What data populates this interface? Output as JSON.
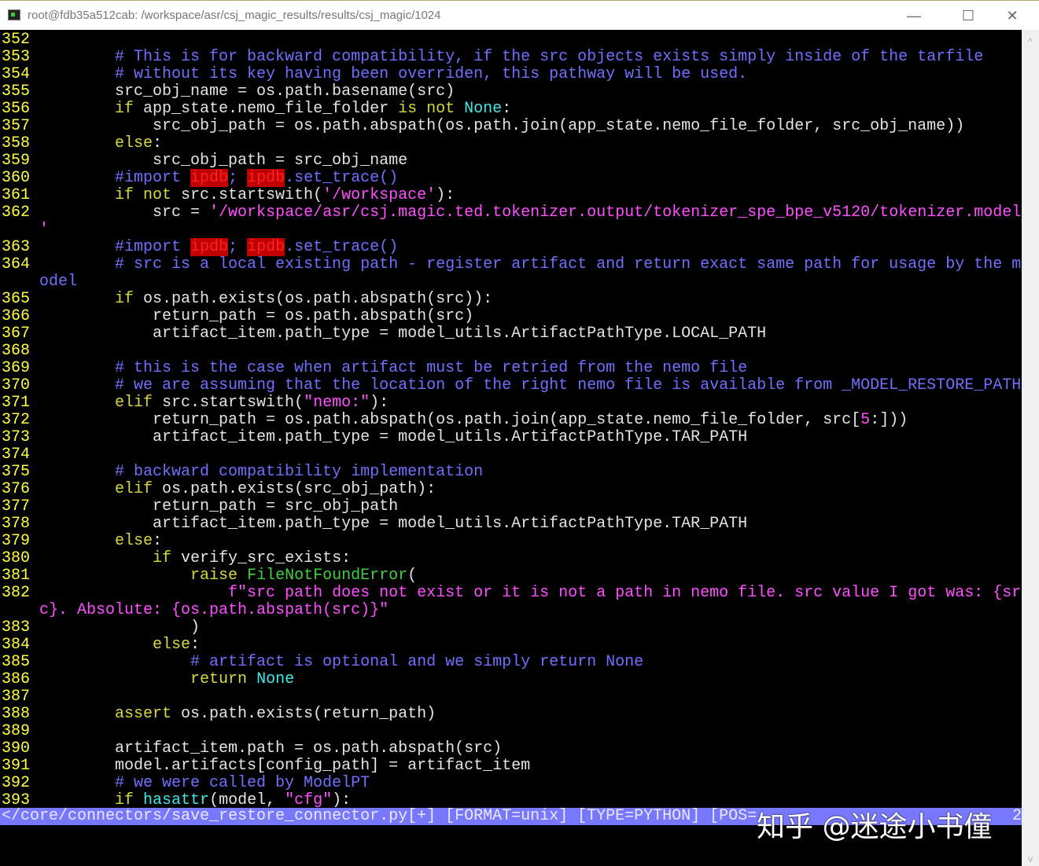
{
  "window": {
    "title": "root@fdb35a512cab: /workspace/asr/csj_magic_results/results/csj_magic/1024",
    "minimize": "—",
    "maximize": "☐",
    "close": "✕"
  },
  "colors": {
    "line_number": "#ffff40",
    "keyword": "#d8d840",
    "comment": "#7070ff",
    "string": "#ff50ff",
    "builtin": "#40e8e8",
    "exception": "#40d040",
    "search_highlight": "#c00000",
    "status_bg": "#7878ff"
  },
  "rows": [
    {
      "num": "352",
      "t": []
    },
    {
      "num": "353",
      "t": [
        [
          "n",
          "        "
        ],
        [
          "c",
          "# This is for backward compatibility, if the src objects exists simply inside of the tarfile"
        ]
      ]
    },
    {
      "num": "354",
      "t": [
        [
          "n",
          "        "
        ],
        [
          "c",
          "# without its key having been overriden, this pathway will be used."
        ]
      ]
    },
    {
      "num": "355",
      "t": [
        [
          "n",
          "        src_obj_name = os.path.basename(src)"
        ]
      ]
    },
    {
      "num": "356",
      "t": [
        [
          "n",
          "        "
        ],
        [
          "k",
          "if"
        ],
        [
          "n",
          " app_state.nemo_file_folder "
        ],
        [
          "k",
          "is not"
        ],
        [
          "n",
          " "
        ],
        [
          "b",
          "None"
        ],
        [
          "n",
          ":"
        ]
      ]
    },
    {
      "num": "357",
      "t": [
        [
          "n",
          "            src_obj_path = os.path.abspath(os.path.join(app_state.nemo_file_folder, src_obj_name))"
        ]
      ]
    },
    {
      "num": "358",
      "t": [
        [
          "n",
          "        "
        ],
        [
          "k",
          "else"
        ],
        [
          "n",
          ":"
        ]
      ]
    },
    {
      "num": "359",
      "t": [
        [
          "n",
          "            src_obj_path = src_obj_name"
        ]
      ]
    },
    {
      "num": "360",
      "t": [
        [
          "n",
          "        "
        ],
        [
          "c",
          "#import "
        ],
        [
          "h",
          "ipdb"
        ],
        [
          "c",
          "; "
        ],
        [
          "h",
          "ipdb"
        ],
        [
          "c",
          ".set_trace()"
        ]
      ]
    },
    {
      "num": "361",
      "t": [
        [
          "n",
          "        "
        ],
        [
          "k",
          "if not"
        ],
        [
          "n",
          " src.startswith("
        ],
        [
          "s",
          "'/workspace'"
        ],
        [
          "n",
          "):"
        ]
      ]
    },
    {
      "num": "362",
      "t": [
        [
          "n",
          "            src = "
        ],
        [
          "s",
          "'/workspace/asr/csj.magic.ted.tokenizer.output/tokenizer_spe_bpe_v5120/tokenizer.model"
        ]
      ]
    },
    {
      "num": "",
      "t": [
        [
          "s",
          "'"
        ]
      ]
    },
    {
      "num": "363",
      "t": [
        [
          "n",
          "        "
        ],
        [
          "c",
          "#import "
        ],
        [
          "h",
          "ipdb"
        ],
        [
          "c",
          "; "
        ],
        [
          "h",
          "ipdb"
        ],
        [
          "c",
          ".set_trace()"
        ]
      ]
    },
    {
      "num": "364",
      "t": [
        [
          "n",
          "        "
        ],
        [
          "c",
          "# src is a local existing path - register artifact and return exact same path for usage by the m"
        ]
      ]
    },
    {
      "num": "",
      "t": [
        [
          "c",
          "odel"
        ]
      ]
    },
    {
      "num": "365",
      "t": [
        [
          "n",
          "        "
        ],
        [
          "k",
          "if"
        ],
        [
          "n",
          " os.path.exists(os.path.abspath(src)):"
        ]
      ]
    },
    {
      "num": "366",
      "t": [
        [
          "n",
          "            return_path = os.path.abspath(src)"
        ]
      ]
    },
    {
      "num": "367",
      "t": [
        [
          "n",
          "            artifact_item.path_type = model_utils.ArtifactPathType.LOCAL_PATH"
        ]
      ]
    },
    {
      "num": "368",
      "t": []
    },
    {
      "num": "369",
      "t": [
        [
          "n",
          "        "
        ],
        [
          "c",
          "# this is the case when artifact must be retried from the nemo file"
        ]
      ]
    },
    {
      "num": "370",
      "t": [
        [
          "n",
          "        "
        ],
        [
          "c",
          "# we are assuming that the location of the right nemo file is available from _MODEL_RESTORE_PATH"
        ]
      ]
    },
    {
      "num": "371",
      "t": [
        [
          "n",
          "        "
        ],
        [
          "k",
          "elif"
        ],
        [
          "n",
          " src.startswith("
        ],
        [
          "s",
          "\"nemo:\""
        ],
        [
          "n",
          "):"
        ]
      ]
    },
    {
      "num": "372",
      "t": [
        [
          "n",
          "            return_path = os.path.abspath(os.path.join(app_state.nemo_file_folder, src["
        ],
        [
          "s",
          "5"
        ],
        [
          "n",
          ":]))"
        ]
      ]
    },
    {
      "num": "373",
      "t": [
        [
          "n",
          "            artifact_item.path_type = model_utils.ArtifactPathType.TAR_PATH"
        ]
      ]
    },
    {
      "num": "374",
      "t": []
    },
    {
      "num": "375",
      "t": [
        [
          "n",
          "        "
        ],
        [
          "c",
          "# backward compatibility implementation"
        ]
      ]
    },
    {
      "num": "376",
      "t": [
        [
          "n",
          "        "
        ],
        [
          "k",
          "elif"
        ],
        [
          "n",
          " os.path.exists(src_obj_path):"
        ]
      ]
    },
    {
      "num": "377",
      "t": [
        [
          "n",
          "            return_path = src_obj_path"
        ]
      ]
    },
    {
      "num": "378",
      "t": [
        [
          "n",
          "            artifact_item.path_type = model_utils.ArtifactPathType.TAR_PATH"
        ]
      ]
    },
    {
      "num": "379",
      "t": [
        [
          "n",
          "        "
        ],
        [
          "k",
          "else"
        ],
        [
          "n",
          ":"
        ]
      ]
    },
    {
      "num": "380",
      "t": [
        [
          "n",
          "            "
        ],
        [
          "k",
          "if"
        ],
        [
          "n",
          " verify_src_exists:"
        ]
      ]
    },
    {
      "num": "381",
      "t": [
        [
          "n",
          "                "
        ],
        [
          "k",
          "raise"
        ],
        [
          "n",
          " "
        ],
        [
          "e",
          "FileNotFoundError"
        ],
        [
          "n",
          "("
        ]
      ]
    },
    {
      "num": "382",
      "t": [
        [
          "n",
          "                    "
        ],
        [
          "s",
          "f\"src path does not exist or it is not a path in nemo file. src value I got was: {sr"
        ]
      ]
    },
    {
      "num": "",
      "t": [
        [
          "s",
          "c}. Absolute: {os.path.abspath(src)}\""
        ]
      ]
    },
    {
      "num": "383",
      "t": [
        [
          "n",
          "                )"
        ]
      ]
    },
    {
      "num": "384",
      "t": [
        [
          "n",
          "            "
        ],
        [
          "k",
          "else"
        ],
        [
          "n",
          ":"
        ]
      ]
    },
    {
      "num": "385",
      "t": [
        [
          "n",
          "                "
        ],
        [
          "c",
          "# artifact is optional and we simply return None"
        ]
      ]
    },
    {
      "num": "386",
      "t": [
        [
          "n",
          "                "
        ],
        [
          "k",
          "return"
        ],
        [
          "n",
          " "
        ],
        [
          "b",
          "None"
        ]
      ]
    },
    {
      "num": "387",
      "t": []
    },
    {
      "num": "388",
      "t": [
        [
          "n",
          "        "
        ],
        [
          "k",
          "assert"
        ],
        [
          "n",
          " os.path.exists(return_path)"
        ]
      ]
    },
    {
      "num": "389",
      "t": []
    },
    {
      "num": "390",
      "t": [
        [
          "n",
          "        artifact_item.path = os.path.abspath(src)"
        ]
      ]
    },
    {
      "num": "391",
      "t": [
        [
          "n",
          "        model.artifacts[config_path] = artifact_item"
        ]
      ]
    },
    {
      "num": "392",
      "t": [
        [
          "n",
          "        "
        ],
        [
          "c",
          "# we were called by ModelPT"
        ]
      ]
    },
    {
      "num": "393",
      "t": [
        [
          "n",
          "        "
        ],
        [
          "k",
          "if"
        ],
        [
          "n",
          " "
        ],
        [
          "b",
          "hasattr"
        ],
        [
          "n",
          "(model, "
        ],
        [
          "s",
          "\"cfg\""
        ],
        [
          "n",
          "):"
        ]
      ]
    }
  ],
  "status": {
    "text": "</core/connectors/save_restore_connector.py[+] [FORMAT=unix] [TYPE=PYTHON] [POS=",
    "tail": "2"
  },
  "watermark": "知乎 @迷途小书僮",
  "scrollbar": {
    "up": "^",
    "down": "v"
  }
}
